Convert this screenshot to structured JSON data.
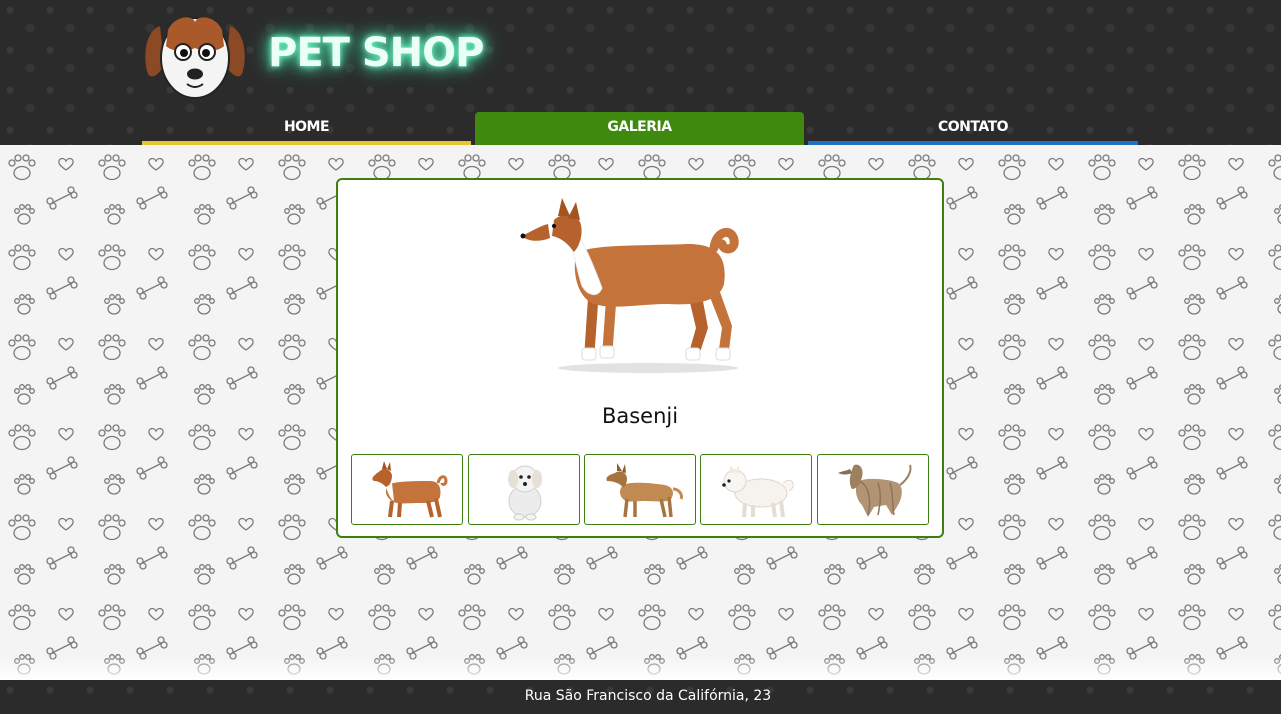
{
  "header": {
    "site_title": "PET SHOP",
    "logo_icon": "dog-face-icon"
  },
  "nav": {
    "items": [
      {
        "label": "HOME",
        "underline_color": "#e8c530"
      },
      {
        "label": "GALERIA",
        "active": true,
        "background_color": "#3f8a0e"
      },
      {
        "label": "CONTATO",
        "underline_color": "#1f6fc4"
      }
    ]
  },
  "gallery": {
    "selected_caption": "Basenji",
    "border_color": "#3f7f12",
    "thumbnails": [
      {
        "icon": "basenji-thumbnail",
        "selected": true
      },
      {
        "icon": "white-fluffy-dog-thumbnail"
      },
      {
        "icon": "tan-dog-thumbnail"
      },
      {
        "icon": "white-spitz-thumbnail"
      },
      {
        "icon": "afghan-hound-thumbnail"
      }
    ]
  },
  "footer": {
    "address": "Rua São Francisco da Califórnia, 23"
  }
}
